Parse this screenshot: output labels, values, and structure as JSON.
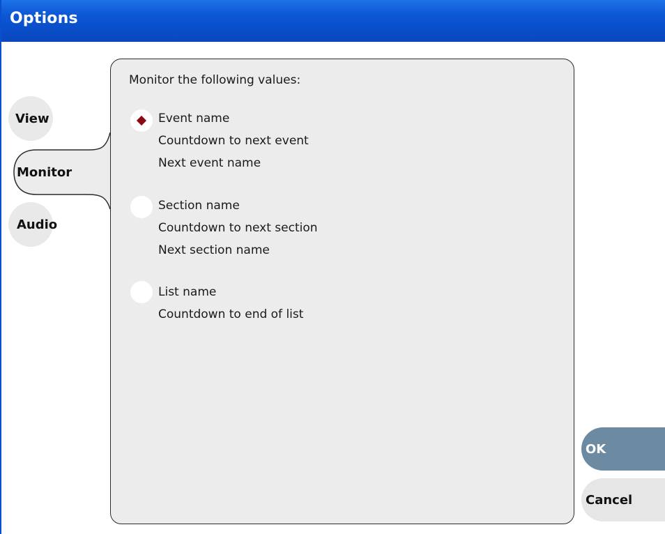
{
  "window": {
    "title": "Options"
  },
  "tabs": [
    {
      "label": "View",
      "active": false
    },
    {
      "label": "Monitor",
      "active": true
    },
    {
      "label": "Audio",
      "active": false
    }
  ],
  "monitor": {
    "heading": "Monitor the following values:",
    "options": [
      {
        "lines": [
          "Event name",
          "Countdown to next event",
          "Next event name"
        ],
        "selected": true
      },
      {
        "lines": [
          "Section name",
          "Countdown to next section",
          "Next section name"
        ],
        "selected": false
      },
      {
        "lines": [
          "List name",
          "Countdown to end of list"
        ],
        "selected": false
      }
    ]
  },
  "buttons": {
    "ok_label": "OK",
    "cancel_label": "Cancel"
  },
  "colors": {
    "titlebar": "#0a4ec9",
    "panel": "#ececec",
    "selected_dot": "#8b0b12",
    "ok_button": "#6d8aa3"
  }
}
